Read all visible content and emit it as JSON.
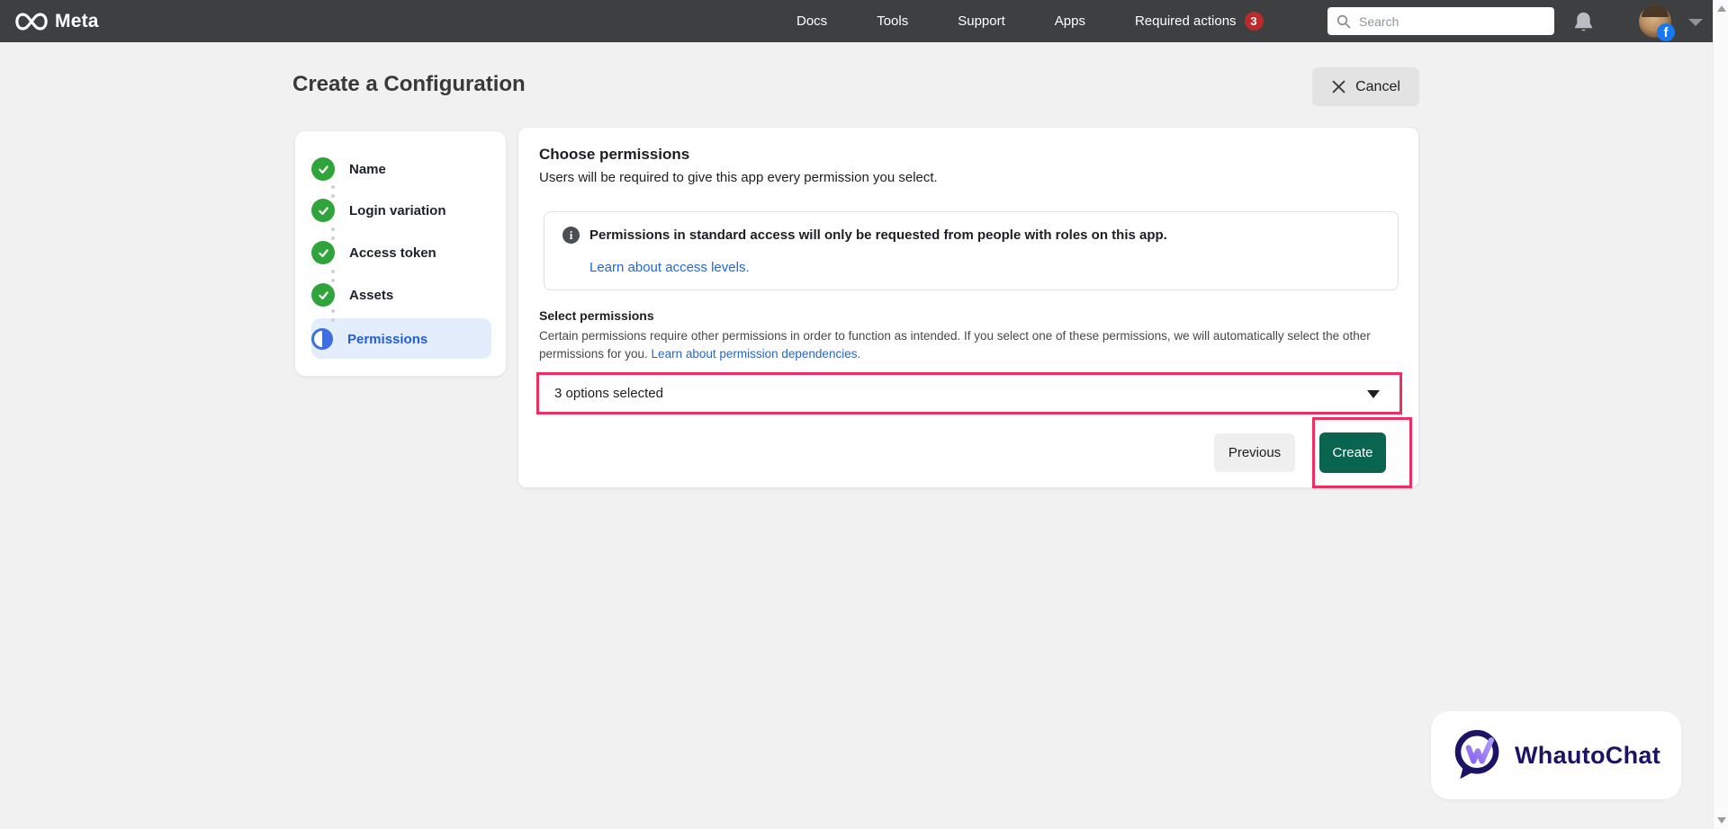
{
  "header": {
    "brand": "Meta",
    "nav": {
      "docs": "Docs",
      "tools": "Tools",
      "support": "Support",
      "apps": "Apps",
      "required_actions": "Required actions",
      "required_actions_count": "3"
    },
    "search": {
      "placeholder": "Search"
    },
    "fb_badge_letter": "f",
    "colors": {
      "bar": "#3e3f41",
      "badge_red": "#b92c2c",
      "facebook_blue": "#1877f2"
    }
  },
  "page": {
    "title": "Create a Configuration",
    "cancel_label": "Cancel"
  },
  "steps": {
    "items": [
      {
        "label": "Name",
        "state": "complete"
      },
      {
        "label": "Login variation",
        "state": "complete"
      },
      {
        "label": "Access token",
        "state": "complete"
      },
      {
        "label": "Assets",
        "state": "complete"
      },
      {
        "label": "Permissions",
        "state": "active"
      }
    ],
    "colors": {
      "complete_green": "#2fa43a",
      "active_blue": "#2160d6",
      "active_bg": "#e3edfb"
    }
  },
  "panel": {
    "heading": "Choose permissions",
    "subheading": "Users will be required to give this app every permission you select.",
    "info": {
      "icon_glyph": "i",
      "text": "Permissions in standard access will only be requested from people with roles on this app.",
      "link": "Learn about access levels."
    },
    "select_section": {
      "heading": "Select permissions",
      "description": "Certain permissions require other permissions in order to function as intended. If you select one of these permissions, we will automatically select the other permissions for you. ",
      "link": "Learn about permission dependencies.",
      "dropdown_value": "3 options selected"
    },
    "buttons": {
      "previous": "Previous",
      "create": "Create"
    },
    "colors": {
      "link_blue": "#2167d8",
      "create_green": "#0a6550",
      "annotation_pink": "#ed2e5f"
    }
  },
  "watermark": {
    "brand": "WhautoChat",
    "color_navy": "#1b1464",
    "color_purple": "#8a63f0"
  }
}
